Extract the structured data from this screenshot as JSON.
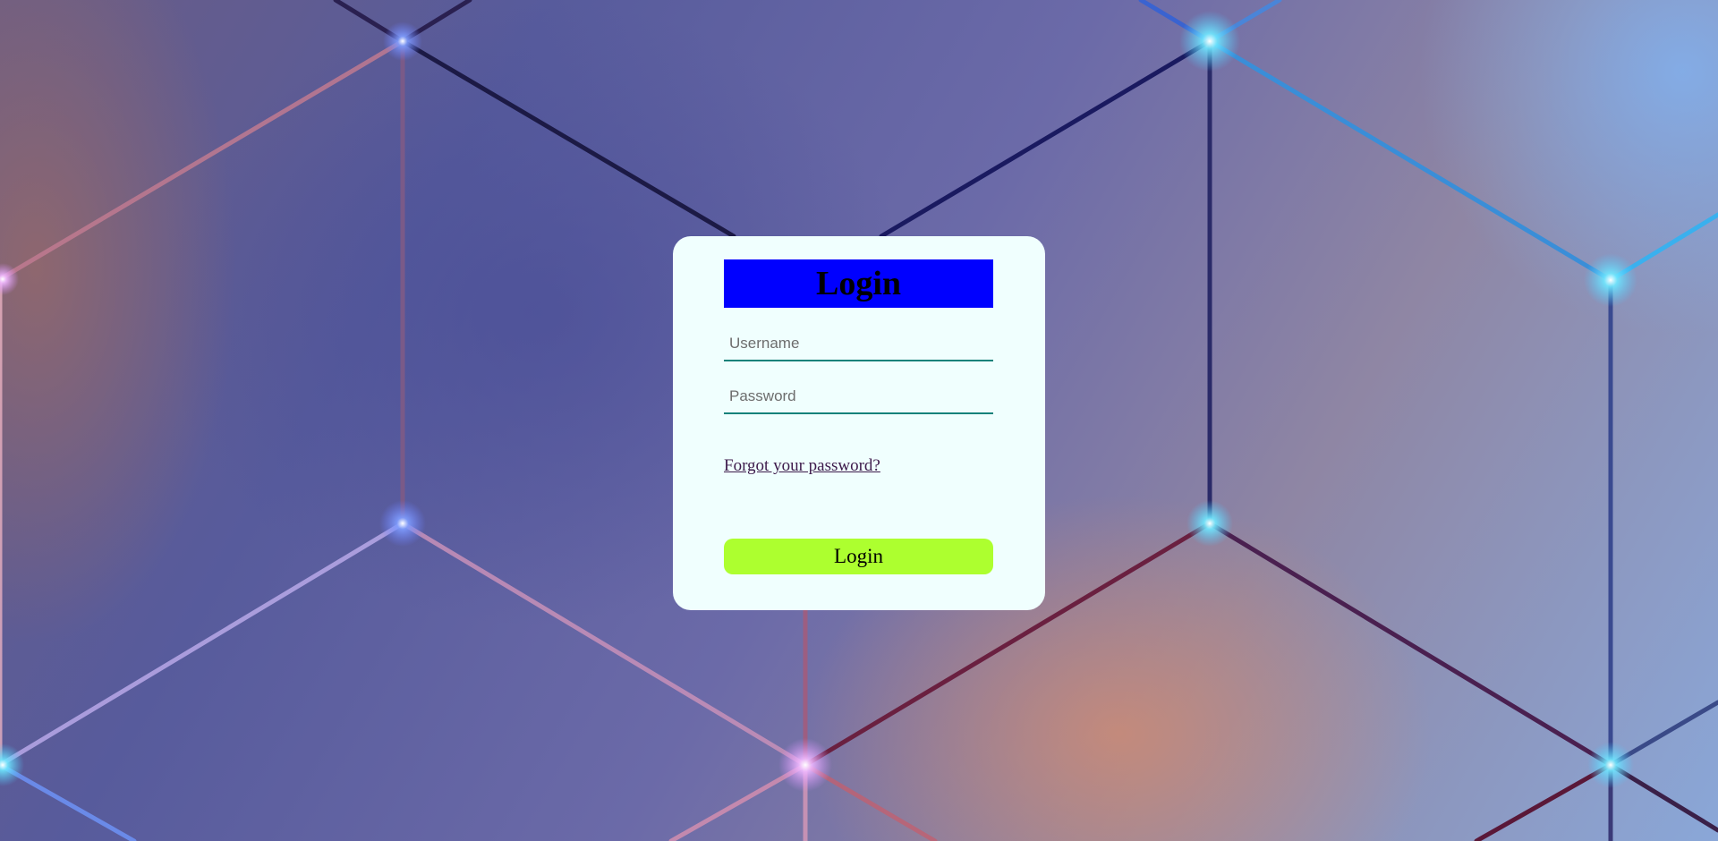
{
  "login_card": {
    "title": "Login",
    "username_placeholder": "Username",
    "password_placeholder": "Password",
    "forgot_link": "Forgot your password?",
    "submit_label": "Login"
  },
  "colors": {
    "card_background": "#f0fffe",
    "title_background": "#0000ff",
    "input_underline": "#11827a",
    "button_background": "#adff2f"
  }
}
